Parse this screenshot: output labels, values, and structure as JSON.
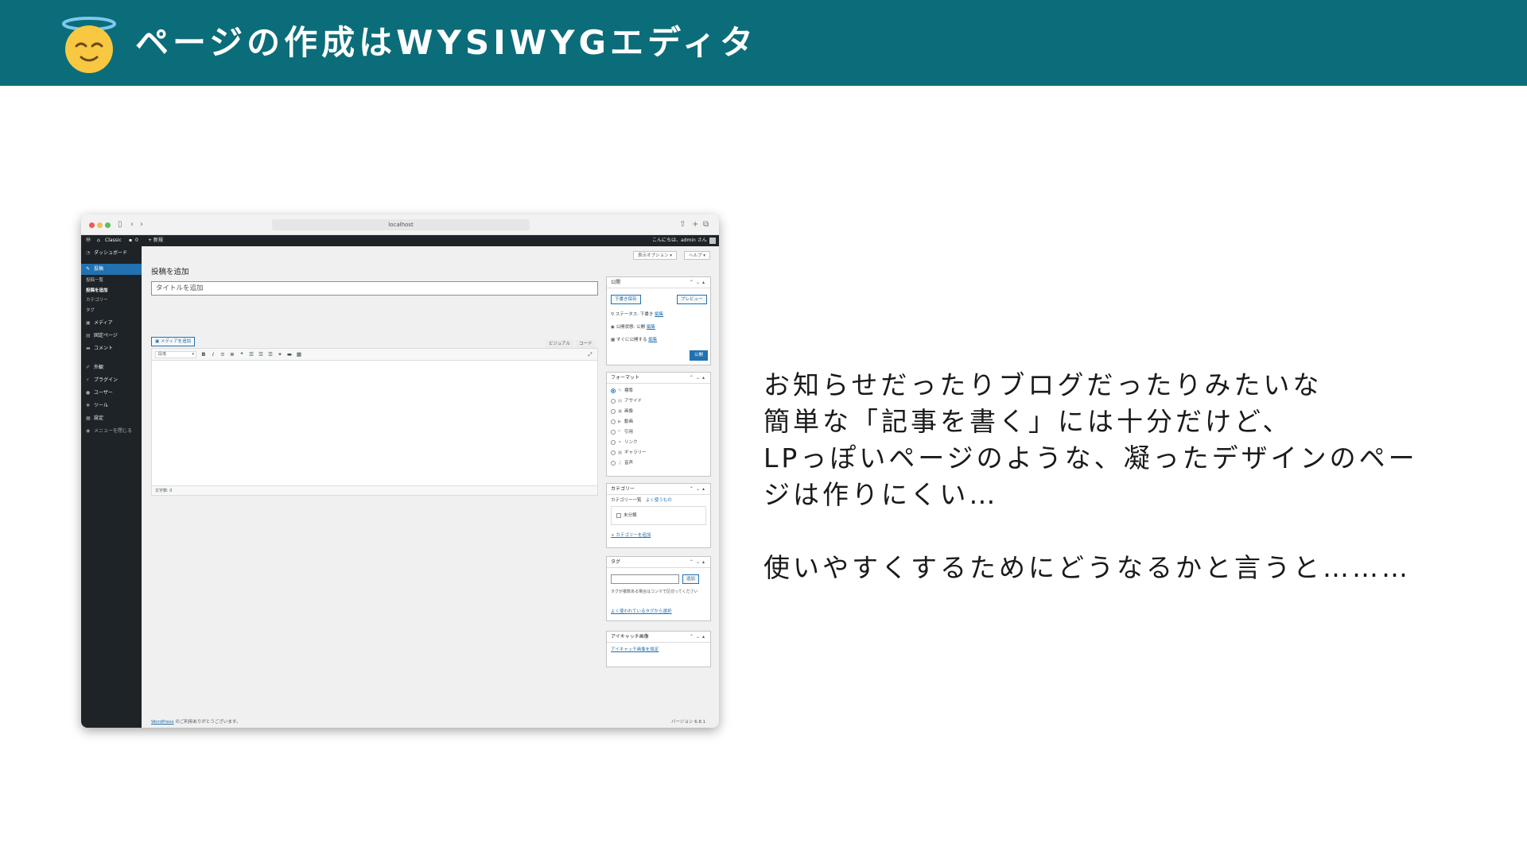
{
  "slide": {
    "title": "ページの作成はWYSIWYGエディタ",
    "emoji_icon": "smiling-face-with-halo-icon",
    "header_color": "#0b6d79"
  },
  "window": {
    "url": "localhost",
    "admin_bar": {
      "site_name": "Classic",
      "comments_count": "0",
      "new_label": "+ 新規",
      "greeting": "こんにちは、admin さん"
    },
    "side_menu": {
      "items": [
        {
          "icon": "dashboard-icon",
          "label": "ダッシュボード"
        },
        {
          "icon": "pin-icon",
          "label": "投稿"
        },
        {
          "icon": "media-icon",
          "label": "メディア"
        },
        {
          "icon": "page-icon",
          "label": "固定ページ"
        },
        {
          "icon": "comment-icon",
          "label": "コメント"
        },
        {
          "icon": "appearance-icon",
          "label": "外観"
        },
        {
          "icon": "plugin-icon",
          "label": "プラグイン"
        },
        {
          "icon": "user-icon",
          "label": "ユーザー"
        },
        {
          "icon": "tool-icon",
          "label": "ツール"
        },
        {
          "icon": "settings-icon",
          "label": "設定"
        },
        {
          "icon": "collapse-icon",
          "label": "メニューを閉じる"
        }
      ],
      "sub_items": [
        "投稿一覧",
        "投稿を追加",
        "カテゴリー",
        "タグ"
      ]
    },
    "screen_options": "表示オプション ▾",
    "help": "ヘルプ ▾",
    "page_heading": "投稿を追加",
    "title_placeholder": "タイトルを追加",
    "add_media": "メディアを追加",
    "tab_visual": "ビジュアル",
    "tab_code": "コード",
    "format_select": "段落",
    "word_count": "文字数: 0",
    "publish_box": {
      "title": "公開",
      "save_draft": "下書き保存",
      "preview": "プレビュー",
      "status": "ステータス: 下書き",
      "visibility": "公開状態: 公開",
      "schedule": "すぐに公開する",
      "edit_link": "編集",
      "publish_button": "公開"
    },
    "format_box": {
      "title": "フォーマット",
      "options": [
        "標準",
        "アサイド",
        "画像",
        "動画",
        "引用",
        "リンク",
        "ギャラリー",
        "音声"
      ]
    },
    "category_box": {
      "title": "カテゴリー",
      "tab_all": "カテゴリー一覧",
      "tab_popular": "よく使うもの",
      "item": "未分類",
      "add_link": "+ カテゴリーを追加"
    },
    "tag_box": {
      "title": "タグ",
      "add_button": "追加",
      "help": "タグが複数ある場合はコンマで区切ってください",
      "popular_link": "よく使われているタグから選択"
    },
    "eyecatch_box": {
      "title": "アイキャッチ画像",
      "set_link": "アイキャッチ画像を設定"
    },
    "footer_left_link": "WordPress",
    "footer_left": " のご利用ありがとうございます。",
    "footer_right": "バージョン 6.8.1"
  },
  "body_text": {
    "lines": [
      "お知らせだったりブログだったりみたいな",
      "簡単な「記事を書く」には十分だけど、",
      "LPっぽいページのような、凝ったデザインのペー",
      "ジは作りにくい…",
      "",
      "使いやすくするためにどうなるかと言うと………"
    ]
  }
}
